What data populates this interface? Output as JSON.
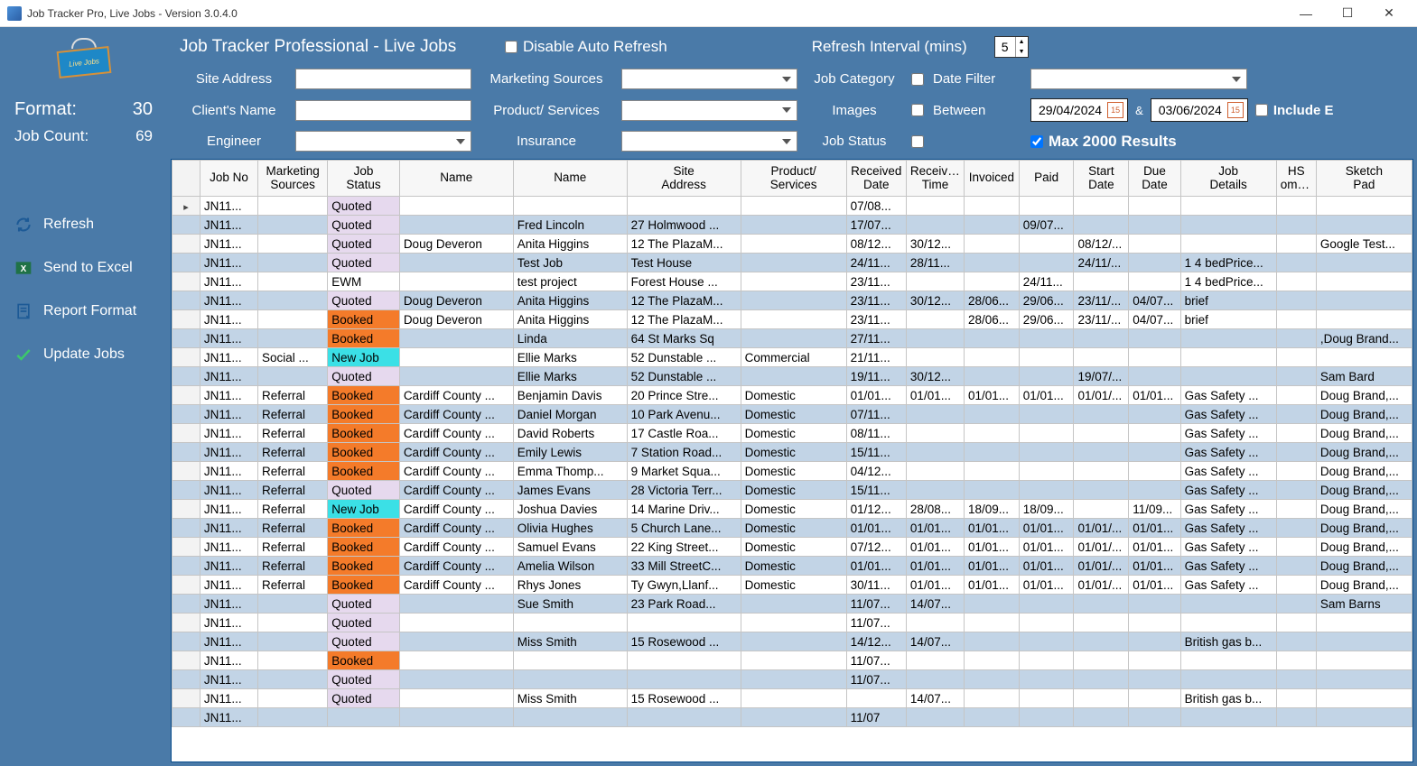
{
  "window": {
    "title": "Job Tracker Pro, Live Jobs - Version 3.0.4.0"
  },
  "sidebar": {
    "logo_text": "Live Jobs",
    "format_label": "Format:",
    "format_value": "30",
    "jobcount_label": "Job Count:",
    "jobcount_value": "69",
    "nav": {
      "refresh": "Refresh",
      "excel": "Send to Excel",
      "report": "Report Format",
      "update": "Update Jobs"
    }
  },
  "filters": {
    "heading": "Job Tracker Professional - Live Jobs",
    "disable_auto_refresh": "Disable Auto Refresh",
    "refresh_interval_label": "Refresh Interval (mins)",
    "refresh_interval_value": "5",
    "site_address": "Site Address",
    "clients_name": "Client's Name",
    "engineer": "Engineer",
    "marketing_sources": "Marketing Sources",
    "product_services": "Product/ Services",
    "insurance": "Insurance",
    "job_category": "Job Category",
    "images": "Images",
    "job_status": "Job Status",
    "date_filter": "Date Filter",
    "between": "Between",
    "date_from": "29/04/2024",
    "date_to": "03/06/2024",
    "amp": "&",
    "include_e": "Include E",
    "max_results": "Max 2000 Results"
  },
  "table": {
    "headers": [
      "",
      "Job No",
      "Marketing Sources",
      "Job Status",
      "Name",
      "Name",
      "Site Address",
      "Product/ Services",
      "Received Date",
      "Received Time",
      "Invoiced",
      "Paid",
      "Start Date",
      "Due Date",
      "Job Details",
      "HS omplet",
      "Sketch Pad"
    ],
    "status_classes": {
      "Quoted": "st-quoted",
      "Booked": "st-booked",
      "New Job": "st-newjob",
      "EWM": "st-ewm"
    },
    "rows": [
      {
        "sel": true,
        "cells": [
          "JN11...",
          "",
          "Quoted",
          "",
          "",
          "",
          "",
          "07/08...",
          "",
          "",
          "",
          "",
          "",
          "",
          "",
          ""
        ]
      },
      {
        "alt": true,
        "cells": [
          "JN11...",
          "",
          "Quoted",
          "",
          "Fred Lincoln",
          "27 Holmwood ...",
          "",
          "17/07...",
          "",
          "",
          "09/07...",
          "",
          "",
          "",
          "",
          ""
        ]
      },
      {
        "cells": [
          "JN11...",
          "",
          "Quoted",
          "Doug Deveron",
          "Anita Higgins",
          "12 The PlazaM...",
          "",
          "08/12...",
          "30/12...",
          "",
          "",
          "08/12/...",
          "",
          "",
          "",
          "Google Test..."
        ]
      },
      {
        "alt": true,
        "cells": [
          "JN11...",
          "",
          "Quoted",
          "",
          "Test Job",
          "Test House",
          "",
          "24/11...",
          "28/11...",
          "",
          "",
          "24/11/...",
          "",
          "1 4 bedPrice...",
          "",
          ""
        ]
      },
      {
        "cells": [
          "JN11...",
          "",
          "EWM",
          "",
          "test project",
          "Forest House ...",
          "",
          "23/11...",
          "",
          "",
          "24/11...",
          "",
          "",
          "1 4 bedPrice...",
          "",
          ""
        ]
      },
      {
        "alt": true,
        "cells": [
          "JN11...",
          "",
          "Quoted",
          "Doug Deveron",
          "Anita Higgins",
          "12 The PlazaM...",
          "",
          "23/11...",
          "30/12...",
          "28/06...",
          "29/06...",
          "23/11/...",
          "04/07...",
          "brief",
          "",
          ""
        ]
      },
      {
        "cells": [
          "JN11...",
          "",
          "Booked",
          "Doug Deveron",
          "Anita Higgins",
          "12 The PlazaM...",
          "",
          "23/11...",
          "",
          "28/06...",
          "29/06...",
          "23/11/...",
          "04/07...",
          "brief",
          "",
          ""
        ]
      },
      {
        "alt": true,
        "cells": [
          "JN11...",
          "",
          "Booked",
          "",
          "Linda",
          "64 St Marks Sq",
          "",
          "27/11...",
          "",
          "",
          "",
          "",
          "",
          "",
          "",
          ",Doug Brand..."
        ]
      },
      {
        "cells": [
          "JN11...",
          "Social ...",
          "New Job",
          "",
          "Ellie Marks",
          "52 Dunstable ...",
          "Commercial",
          "21/11...",
          "",
          "",
          "",
          "",
          "",
          "",
          "",
          ""
        ]
      },
      {
        "alt": true,
        "cells": [
          "JN11...",
          "",
          "Quoted",
          "",
          "Ellie Marks",
          "52 Dunstable ...",
          "",
          "19/11...",
          "30/12...",
          "",
          "",
          "19/07/...",
          "",
          "",
          "",
          "Sam Bard"
        ]
      },
      {
        "cells": [
          "JN11...",
          "Referral",
          "Booked",
          "Cardiff County ...",
          "Benjamin Davis",
          "20 Prince Stre...",
          "Domestic",
          "01/01...",
          "01/01...",
          "01/01...",
          "01/01...",
          "01/01/...",
          "01/01...",
          "Gas Safety ...",
          "",
          "Doug Brand,..."
        ]
      },
      {
        "alt": true,
        "cells": [
          "JN11...",
          "Referral",
          "Booked",
          "Cardiff County ...",
          "Daniel Morgan",
          "10 Park Avenu...",
          "Domestic",
          "07/11...",
          "",
          "",
          "",
          "",
          "",
          "Gas Safety ...",
          "",
          "Doug Brand,..."
        ]
      },
      {
        "cells": [
          "JN11...",
          "Referral",
          "Booked",
          "Cardiff County ...",
          "David Roberts",
          "17 Castle Roa...",
          "Domestic",
          "08/11...",
          "",
          "",
          "",
          "",
          "",
          "Gas Safety ...",
          "",
          "Doug Brand,..."
        ]
      },
      {
        "alt": true,
        "cells": [
          "JN11...",
          "Referral",
          "Booked",
          "Cardiff County ...",
          "Emily Lewis",
          "7 Station Road...",
          "Domestic",
          "15/11...",
          "",
          "",
          "",
          "",
          "",
          "Gas Safety ...",
          "",
          "Doug Brand,..."
        ]
      },
      {
        "cells": [
          "JN11...",
          "Referral",
          "Booked",
          "Cardiff County ...",
          "Emma Thomp...",
          "9 Market Squa...",
          "Domestic",
          "04/12...",
          "",
          "",
          "",
          "",
          "",
          "Gas Safety ...",
          "",
          "Doug Brand,..."
        ]
      },
      {
        "alt": true,
        "cells": [
          "JN11...",
          "Referral",
          "Quoted",
          "Cardiff County ...",
          "James Evans",
          "28 Victoria Terr...",
          "Domestic",
          "15/11...",
          "",
          "",
          "",
          "",
          "",
          "Gas Safety ...",
          "",
          "Doug Brand,..."
        ]
      },
      {
        "cells": [
          "JN11...",
          "Referral",
          "New Job",
          "Cardiff County ...",
          "Joshua Davies",
          "14 Marine Driv...",
          "Domestic",
          "01/12...",
          "28/08...",
          "18/09...",
          "18/09...",
          "",
          "11/09...",
          "Gas Safety ...",
          "",
          "Doug Brand,..."
        ]
      },
      {
        "alt": true,
        "cells": [
          "JN11...",
          "Referral",
          "Booked",
          "Cardiff County ...",
          "Olivia Hughes",
          "5 Church Lane...",
          "Domestic",
          "01/01...",
          "01/01...",
          "01/01...",
          "01/01...",
          "01/01/...",
          "01/01...",
          "Gas Safety ...",
          "",
          "Doug Brand,..."
        ]
      },
      {
        "cells": [
          "JN11...",
          "Referral",
          "Booked",
          "Cardiff County ...",
          "Samuel Evans",
          "22 King Street...",
          "Domestic",
          "07/12...",
          "01/01...",
          "01/01...",
          "01/01...",
          "01/01/...",
          "01/01...",
          "Gas Safety ...",
          "",
          "Doug Brand,..."
        ]
      },
      {
        "alt": true,
        "cells": [
          "JN11...",
          "Referral",
          "Booked",
          "Cardiff County ...",
          "Amelia Wilson",
          "33 Mill StreetC...",
          "Domestic",
          "01/01...",
          "01/01...",
          "01/01...",
          "01/01...",
          "01/01/...",
          "01/01...",
          "Gas Safety ...",
          "",
          "Doug Brand,..."
        ]
      },
      {
        "cells": [
          "JN11...",
          "Referral",
          "Booked",
          "Cardiff County ...",
          "Rhys Jones",
          "Ty Gwyn,Llanf...",
          "Domestic",
          "30/11...",
          "01/01...",
          "01/01...",
          "01/01...",
          "01/01/...",
          "01/01...",
          "Gas Safety ...",
          "",
          "Doug Brand,..."
        ]
      },
      {
        "alt": true,
        "cells": [
          "JN11...",
          "",
          "Quoted",
          "",
          "Sue Smith",
          "23 Park Road...",
          "",
          "11/07...",
          "14/07...",
          "",
          "",
          "",
          "",
          "",
          "",
          "Sam Barns"
        ]
      },
      {
        "cells": [
          "JN11...",
          "",
          "Quoted",
          "",
          "",
          "",
          "",
          "11/07...",
          "",
          "",
          "",
          "",
          "",
          "",
          "",
          ""
        ]
      },
      {
        "alt": true,
        "cells": [
          "JN11...",
          "",
          "Quoted",
          "",
          "Miss Smith",
          "15 Rosewood ...",
          "",
          "14/12...",
          "14/07...",
          "",
          "",
          "",
          "",
          "British gas b...",
          "",
          ""
        ]
      },
      {
        "cells": [
          "JN11...",
          "",
          "Booked",
          "",
          "",
          "",
          "",
          "11/07...",
          "",
          "",
          "",
          "",
          "",
          "",
          "",
          ""
        ]
      },
      {
        "alt": true,
        "cells": [
          "JN11...",
          "",
          "Quoted",
          "",
          "",
          "",
          "",
          "11/07...",
          "",
          "",
          "",
          "",
          "",
          "",
          "",
          ""
        ]
      },
      {
        "cells": [
          "JN11...",
          "",
          "Quoted",
          "",
          "Miss Smith",
          "15 Rosewood ...",
          "",
          "",
          "14/07...",
          "",
          "",
          "",
          "",
          "British gas b...",
          "",
          ""
        ]
      },
      {
        "alt": true,
        "cells": [
          "JN11...",
          "",
          "",
          "",
          "",
          "",
          "",
          "11/07",
          "",
          "",
          "",
          "",
          "",
          "",
          "",
          ""
        ]
      }
    ]
  }
}
